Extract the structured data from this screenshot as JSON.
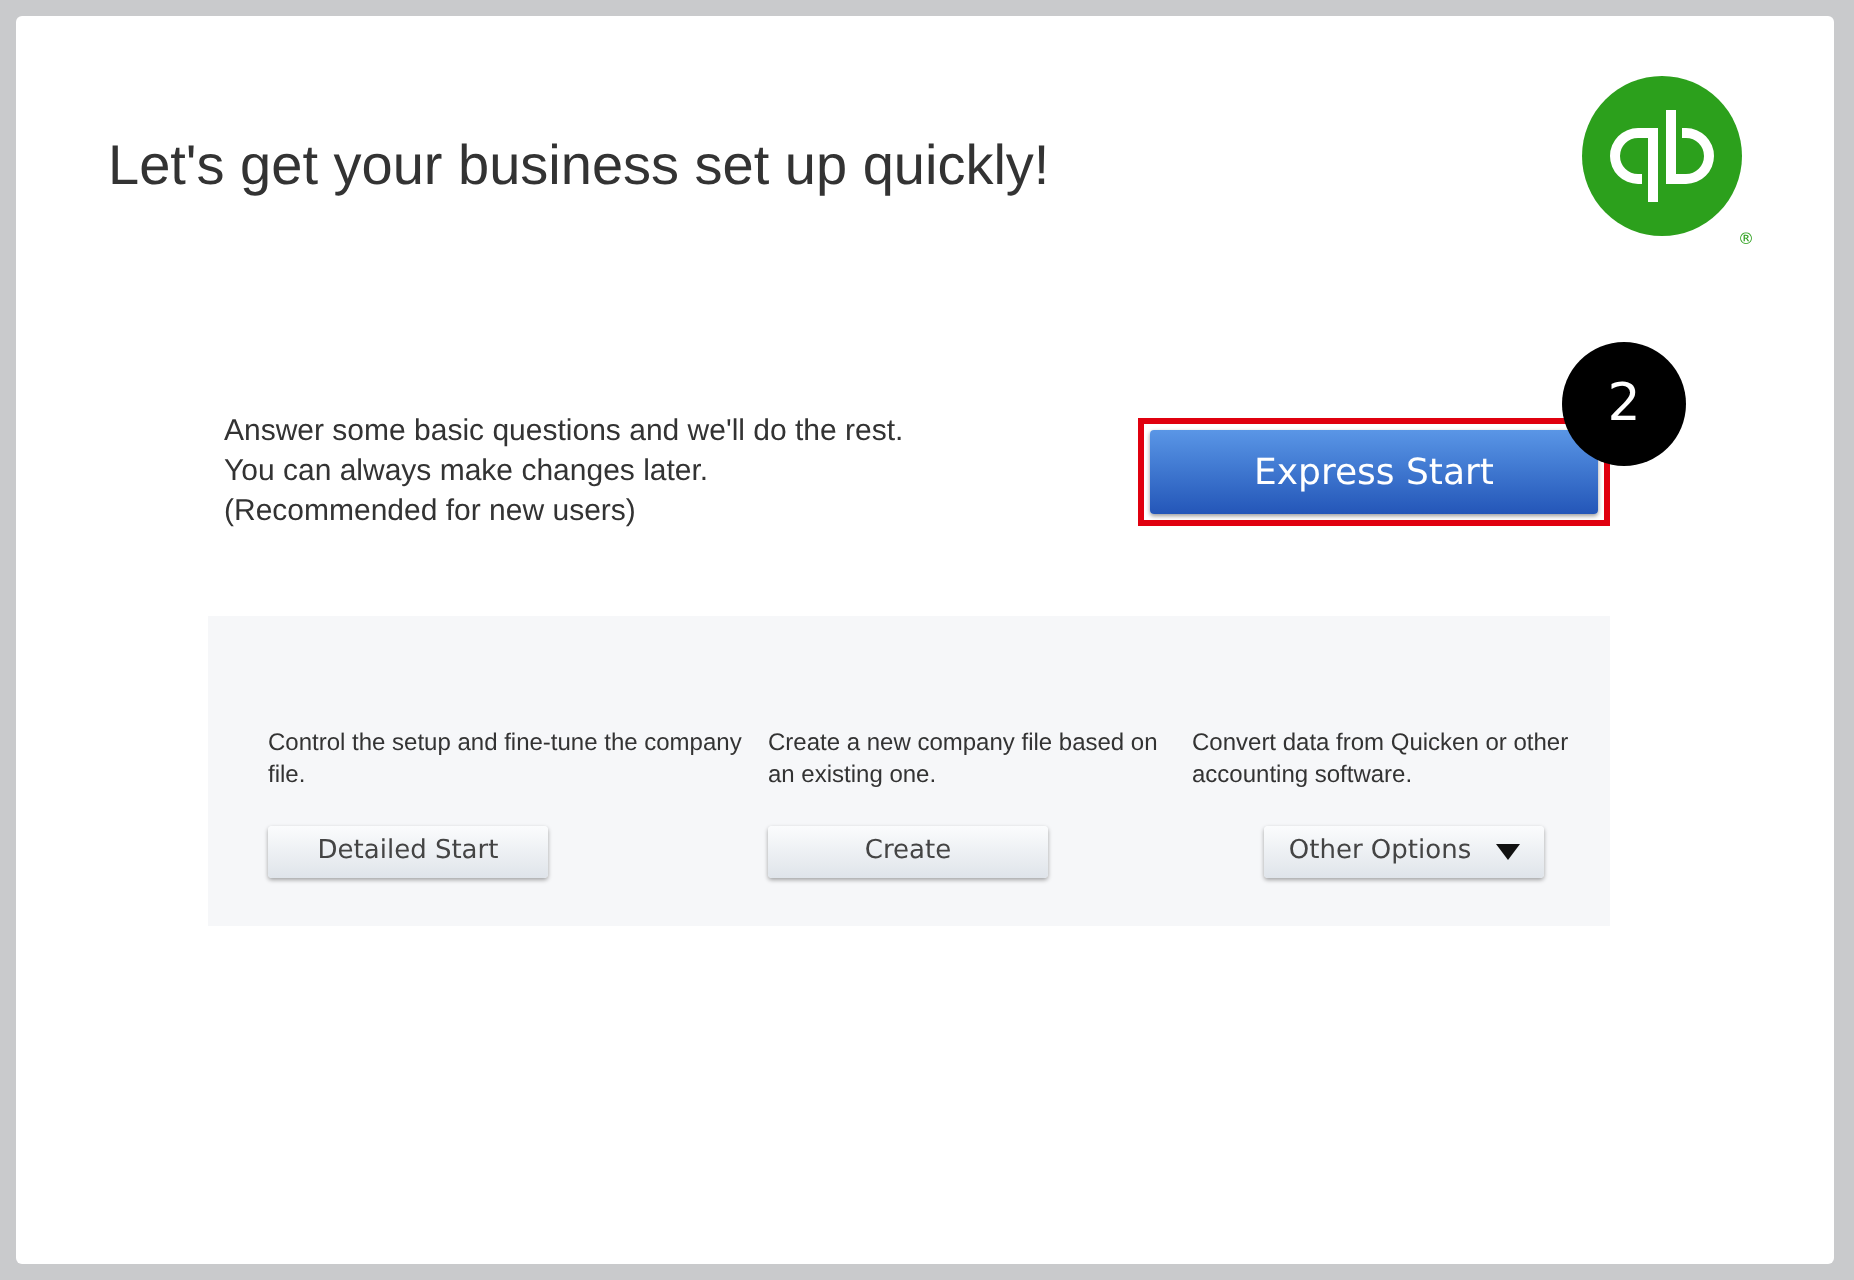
{
  "title": "Let's get your business set up quickly!",
  "logo": {
    "registered": "®"
  },
  "express": {
    "description": "Answer some basic questions and we'll do the rest. You can always make changes later.",
    "note": "(Recommended for new users)",
    "button": "Express Start",
    "highlighted": true,
    "step": "2"
  },
  "options": [
    {
      "kind": "button",
      "description": "Control the setup and fine-tune the company file.",
      "button": "Detailed Start"
    },
    {
      "kind": "button",
      "description": "Create a new company file based on an existing one.",
      "button": "Create"
    },
    {
      "kind": "dropdown",
      "description": "Convert data from Quicken or other accounting software.",
      "button": "Other Options"
    }
  ]
}
